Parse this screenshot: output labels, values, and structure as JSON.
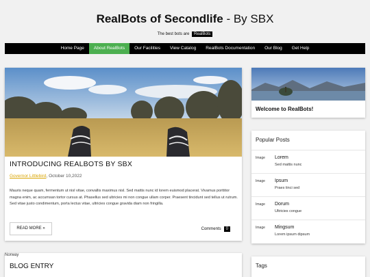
{
  "header": {
    "title_main": "RealBots of Secondlife",
    "title_suffix": " - By SBX",
    "tagline": "The best bots are",
    "tagline_badge": "RealBots"
  },
  "nav": {
    "items": [
      "Home Page",
      "About RealBots",
      "Our Facilities",
      "View Catalog",
      "RealBots Documentation",
      "Our Blog",
      "Get Help"
    ],
    "active": "About RealBots",
    "active_color": "#4CAF50"
  },
  "post": {
    "title": "INTRODUCING REALBOTS BY SBX",
    "author": "Governor Littlebird",
    "date": ", October 10,2022",
    "body": "Mauris neque quam, fermentum ut nisl vitae, convallis maximus nisl. Sed mattis nunc id lorem euismod placerat. Vivamus porttitor magna enim, ac accumsan tortor cursus at. Phasellus sed ultricies mi non congue ullam corper. Praesent tincidunt sed tellus ut rutrum. Sed vitae justo condimentum, porta lectus vitae, ultricies congue gravida diam non fringilla.",
    "read_more": "READ MORE »",
    "comments_label": "Comments",
    "comments_count": "0"
  },
  "sidebar": {
    "welcome_title": "Welcome to RealBots!",
    "popular_heading": "Popular Posts",
    "popular": [
      {
        "img": "Image",
        "title": "Lorem",
        "sub": "Sed mattis nunc"
      },
      {
        "img": "Image",
        "title": "Ipsum",
        "sub": "Praes tinci sed"
      },
      {
        "img": "Image",
        "title": "Dorum",
        "sub": "Ultricies congue"
      },
      {
        "img": "Image",
        "title": "Mingsum",
        "sub": "Lorem ipsum dipsum"
      }
    ],
    "tags_heading": "Tags"
  },
  "blog_entry": {
    "img_alt": "Norway",
    "title": "BLOG ENTRY"
  }
}
